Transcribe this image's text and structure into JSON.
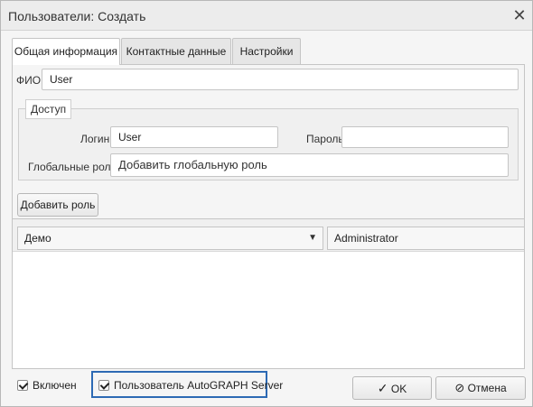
{
  "window": {
    "title": "Пользователи: Создать"
  },
  "tabs": [
    {
      "label": "Общая информация",
      "active": true
    },
    {
      "label": "Контактные данные",
      "active": false
    },
    {
      "label": "Настройки",
      "active": false
    }
  ],
  "form": {
    "fio_label": "ФИО",
    "fio_value": "User",
    "access_legend": "Доступ",
    "login_label": "Логин",
    "login_value": "User",
    "password_label": "Пароль",
    "password_value": "",
    "global_roles_label": "Глобальные роли",
    "global_roles_placeholder": "Добавить глобальную роль",
    "add_role_button": "Добавить роль"
  },
  "roles_grid": {
    "columns": [
      {
        "label": "Демо",
        "has_dropdown": true
      },
      {
        "label": "Administrator",
        "has_dropdown": false
      }
    ],
    "rows": []
  },
  "footer": {
    "enabled_label": "Включен",
    "enabled_checked": true,
    "server_user_label": "Пользователь AutoGRAPH Server",
    "server_user_checked": true,
    "ok_label": "OK",
    "cancel_label": "Отмена"
  },
  "icons": {
    "close": "close-icon",
    "checkmark": "checkmark-icon",
    "cancel": "cancel-icon",
    "dropdown": "chevron-down-icon"
  },
  "colors": {
    "highlight_border": "#2d6ab4"
  }
}
